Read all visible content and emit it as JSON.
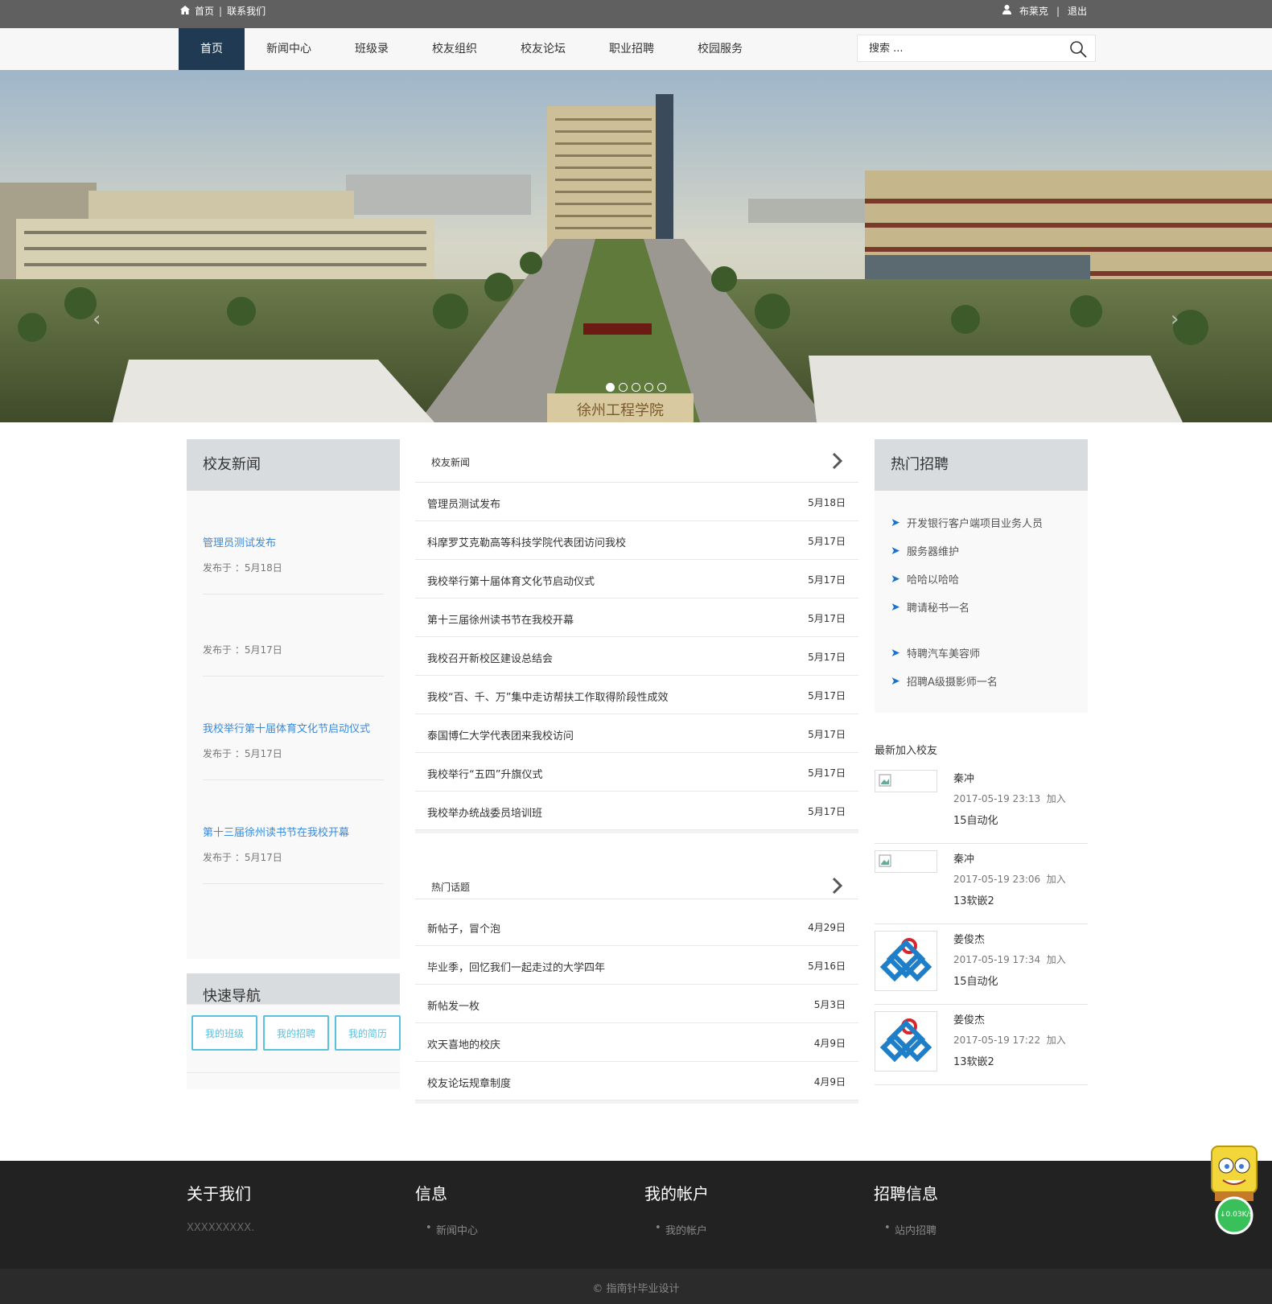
{
  "topbar": {
    "home": "首页",
    "contact": "联系我们",
    "user": "布莱克",
    "logout": "退出"
  },
  "nav": {
    "items": [
      "首页",
      "新闻中心",
      "班级录",
      "校友组织",
      "校友论坛",
      "职业招聘",
      "校园服务"
    ],
    "search_placeholder": "搜索 ..."
  },
  "left": {
    "news_title": "校友新闻",
    "news": [
      {
        "title": "管理员测试发布",
        "date": "发布于 ：5月18日"
      },
      {
        "title": "",
        "date": "发布于 ：5月17日"
      },
      {
        "title": "我校举行第十届体育文化节启动仪式",
        "date": "发布于 ：5月17日"
      },
      {
        "title": "第十三届徐州读书节在我校开幕",
        "date": "发布于 ：5月17日"
      }
    ],
    "quick_title": "快速导航",
    "quick_buttons": [
      "我的班级",
      "我的招聘",
      "我的简历"
    ]
  },
  "center": {
    "news_title": "校友新闻",
    "news": [
      {
        "title": "管理员测试发布",
        "date": "5月18日"
      },
      {
        "title": "科摩罗艾克勒高等科技学院代表团访问我校",
        "date": "5月17日"
      },
      {
        "title": "我校举行第十届体育文化节启动仪式",
        "date": "5月17日"
      },
      {
        "title": "第十三届徐州读书节在我校开幕",
        "date": "5月17日"
      },
      {
        "title": "我校召开新校区建设总结会",
        "date": "5月17日"
      },
      {
        "title": "我校“百、千、万”集中走访帮扶工作取得阶段性成效",
        "date": "5月17日"
      },
      {
        "title": "泰国博仁大学代表团来我校访问",
        "date": "5月17日"
      },
      {
        "title": "我校举行“五四”升旗仪式",
        "date": "5月17日"
      },
      {
        "title": "我校举办统战委员培训班",
        "date": "5月17日"
      }
    ],
    "topics_title": "热门话题",
    "topics": [
      {
        "title": "新帖子，冒个泡",
        "date": "4月29日"
      },
      {
        "title": "毕业季，回忆我们一起走过的大学四年",
        "date": "5月16日"
      },
      {
        "title": "新帖发一枚",
        "date": "5月3日"
      },
      {
        "title": "欢天喜地的校庆",
        "date": "4月9日"
      },
      {
        "title": "校友论坛规章制度",
        "date": "4月9日"
      }
    ]
  },
  "right": {
    "jobs_title": "热门招聘",
    "jobs": [
      "开发银行客户端项目业务人员",
      "服务器维护",
      "哈哈以哈哈",
      "聘请秘书一名",
      "特聘汽车美容师",
      "招聘A级摄影师一名"
    ],
    "members_title": "最新加入校友",
    "join_label": "加入",
    "members": [
      {
        "name": "秦冲",
        "time": "2017-05-19 23:13",
        "class": "15自动化",
        "avatar": "broken-image"
      },
      {
        "name": "秦冲",
        "time": "2017-05-19 23:06",
        "class": "13软嵌2",
        "avatar": "broken-image"
      },
      {
        "name": "姜俊杰",
        "time": "2017-05-19 17:34",
        "class": "15自动化",
        "avatar": "logo-icon"
      },
      {
        "name": "姜俊杰",
        "time": "2017-05-19 17:22",
        "class": "13软嵌2",
        "avatar": "logo-icon"
      }
    ]
  },
  "footer": {
    "about_title": "关于我们",
    "about_text": "XXXXXXXXX.",
    "info_title": "信息",
    "info_link": "新闻中心",
    "account_title": "我的帐户",
    "account_link": "我的帐户",
    "jobs_title": "招聘信息",
    "jobs_link": "站内招聘",
    "copyright": "© 指南针毕业设计"
  },
  "hero": {
    "slides": 5,
    "active_slide": 1,
    "sign_text": "徐州工程学院"
  },
  "mascot": {
    "speed": "↓0.03K/s"
  },
  "colors": {
    "topbar": "#606060",
    "nav_active": "#1f3a52",
    "link_blue": "#3b8ad9",
    "button_teal": "#5bc0de",
    "footer": "#222222"
  }
}
